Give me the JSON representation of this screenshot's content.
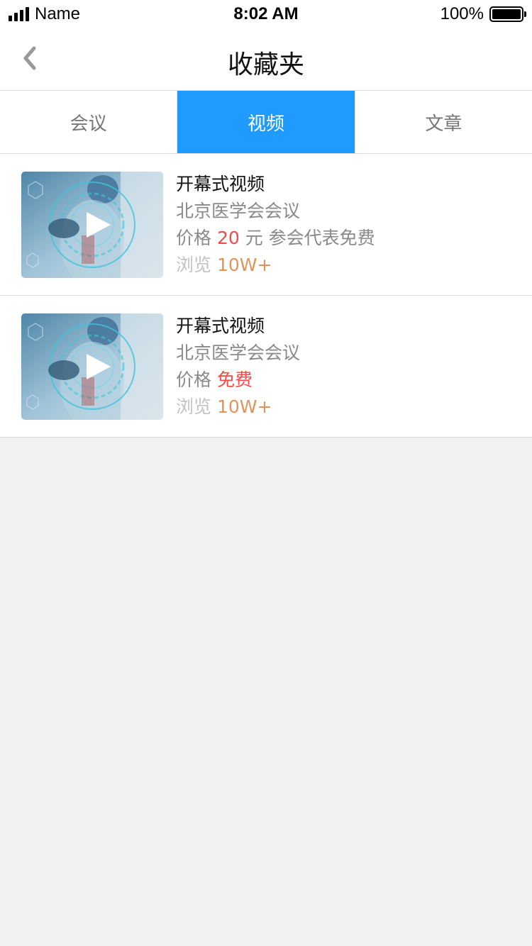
{
  "status_bar": {
    "carrier": "Name",
    "time": "8:02 AM",
    "battery_percent": "100%",
    "battery_level": 1.0
  },
  "header": {
    "title": "收藏夹",
    "back_icon": "chevron-left-icon"
  },
  "tabs": [
    {
      "label": "会议",
      "active": false
    },
    {
      "label": "视频",
      "active": true
    },
    {
      "label": "文章",
      "active": false
    }
  ],
  "items": [
    {
      "title": "开幕式视频",
      "organizer": "北京医学会会议",
      "price_label": "价格",
      "price_value": "20",
      "price_suffix": "元 参会代表免费",
      "views_label": "浏览",
      "views_value": "10W+",
      "thumbnail_icon": "play-icon"
    },
    {
      "title": "开幕式视频",
      "organizer": "北京医学会会议",
      "price_label": "价格",
      "price_value": "免费",
      "price_suffix": "",
      "views_label": "浏览",
      "views_value": "10W+",
      "thumbnail_icon": "play-icon"
    }
  ],
  "colors": {
    "accent": "#1f9bff",
    "price": "#f54a4a",
    "views": "#e0935a",
    "background": "#f1f1f1"
  }
}
